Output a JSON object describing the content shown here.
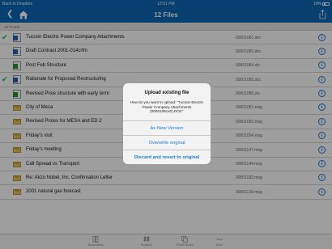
{
  "status_bar": {
    "back_label": "Back to Dropbox",
    "time": "12:51 PM",
    "battery": "18%"
  },
  "nav": {
    "title": "12 Files"
  },
  "section": {
    "header": "12 FILES"
  },
  "files": [
    {
      "name": "Tucson Electric Power Company Attachments",
      "id": "00001081.doc",
      "type": "doc",
      "checked": true
    },
    {
      "name": "Draft Contract 2001-014crfm",
      "id": "00001082.doc",
      "type": "doc",
      "checked": false
    },
    {
      "name": "Post Feb Structure",
      "id": "00001084.xls",
      "type": "xls",
      "checked": false
    },
    {
      "name": "Rationale for Proposed Restructuring",
      "id": "00001085.doc",
      "type": "doc",
      "checked": true
    },
    {
      "name": "Revised Price structure with early term",
      "id": "00001086.xls",
      "type": "xls",
      "checked": false
    },
    {
      "name": "City of Mesa",
      "id": "00001091.msg",
      "type": "msg",
      "checked": false
    },
    {
      "name": "Revised Prices for MESA and ED 2",
      "id": "00001092.msg",
      "type": "msg",
      "checked": false
    },
    {
      "name": "Friday's visit",
      "id": "00001094.msg",
      "type": "msg",
      "checked": false
    },
    {
      "name": "Friday's meeting",
      "id": "00001147.msg",
      "type": "msg",
      "checked": false
    },
    {
      "name": "Call Spread vs Transport",
      "id": "00001144.msg",
      "type": "msg",
      "checked": false
    },
    {
      "name": "Re: Akzo Nobel, Inc. Confirmation Letter",
      "id": "00001182.msg",
      "type": "msg",
      "checked": false
    },
    {
      "name": "2001 natural gas forecast",
      "id": "00001139.msg",
      "type": "msg",
      "checked": false
    }
  ],
  "dialog": {
    "title": "Upload existing file",
    "message": "How do you want to upload: \"Tucson Electric Power Company Attachments (00001081x0).DOC\"",
    "buttons": [
      "As New Version",
      "Overwrite original",
      "Discard and revert to original"
    ]
  },
  "tabbar": {
    "items": [
      {
        "label": "Bookmarks",
        "icon": "bookmarks-icon"
      },
      {
        "label": "Dropbox",
        "icon": "dropbox-icon"
      },
      {
        "label": "Smart Boxes",
        "icon": "smart-boxes-icon"
      },
      {
        "label": "More",
        "icon": "more-icon"
      }
    ]
  },
  "colors": {
    "brand_blue": "#0a67b5",
    "link_blue": "#1a7ad6",
    "check_green": "#2aa65a",
    "status_blue": "#0a67b5"
  }
}
